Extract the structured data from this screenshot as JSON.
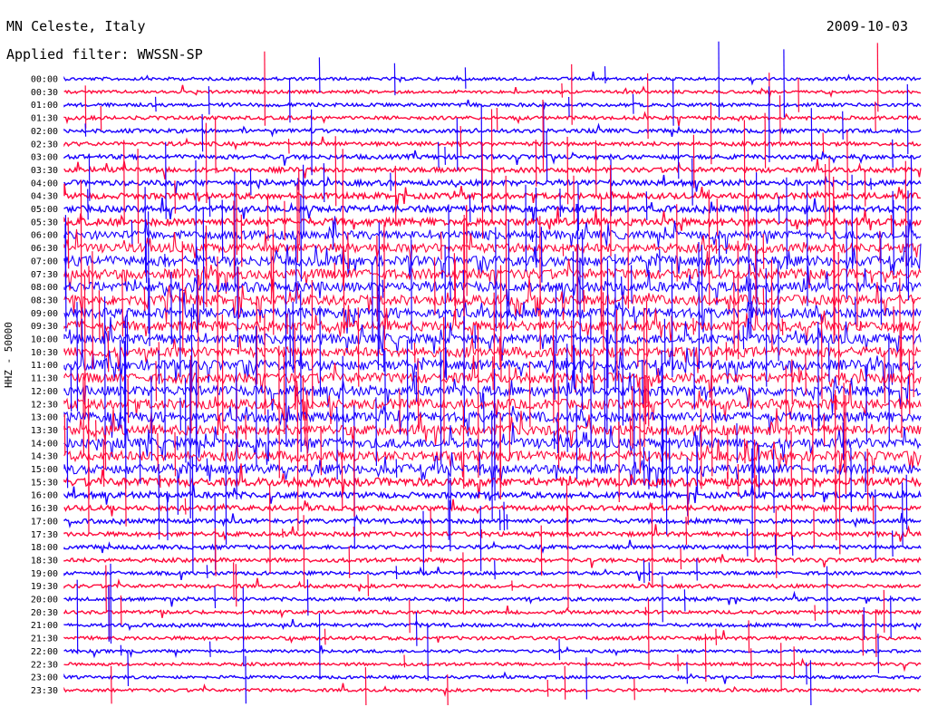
{
  "header": {
    "station": "MN Celeste, Italy",
    "date": "2009-10-03",
    "filter": "Applied filter: WWSSN-SP"
  },
  "chart_data": {
    "type": "line",
    "ylabel": "HHZ - 50000",
    "colors": {
      "blue": "#1a00ff",
      "red": "#ff0a3c"
    },
    "series": [
      {
        "label": "00:00",
        "color": "blue",
        "activity": 0.25
      },
      {
        "label": "00:30",
        "color": "red",
        "activity": 0.25
      },
      {
        "label": "01:00",
        "color": "blue",
        "activity": 0.3
      },
      {
        "label": "01:30",
        "color": "red",
        "activity": 0.3
      },
      {
        "label": "02:00",
        "color": "blue",
        "activity": 0.35
      },
      {
        "label": "02:30",
        "color": "red",
        "activity": 0.35
      },
      {
        "label": "03:00",
        "color": "blue",
        "activity": 0.4
      },
      {
        "label": "03:30",
        "color": "red",
        "activity": 0.45
      },
      {
        "label": "04:00",
        "color": "blue",
        "activity": 0.5
      },
      {
        "label": "04:30",
        "color": "red",
        "activity": 0.55
      },
      {
        "label": "05:00",
        "color": "blue",
        "activity": 0.6
      },
      {
        "label": "05:30",
        "color": "red",
        "activity": 0.7
      },
      {
        "label": "06:00",
        "color": "blue",
        "activity": 0.85
      },
      {
        "label": "06:30",
        "color": "red",
        "activity": 0.9
      },
      {
        "label": "07:00",
        "color": "blue",
        "activity": 1.0
      },
      {
        "label": "07:30",
        "color": "red",
        "activity": 1.0
      },
      {
        "label": "08:00",
        "color": "blue",
        "activity": 1.0
      },
      {
        "label": "08:30",
        "color": "red",
        "activity": 1.0
      },
      {
        "label": "09:00",
        "color": "blue",
        "activity": 1.0
      },
      {
        "label": "09:30",
        "color": "red",
        "activity": 1.0
      },
      {
        "label": "10:00",
        "color": "blue",
        "activity": 1.0
      },
      {
        "label": "10:30",
        "color": "red",
        "activity": 1.0
      },
      {
        "label": "11:00",
        "color": "blue",
        "activity": 1.0
      },
      {
        "label": "11:30",
        "color": "red",
        "activity": 1.0
      },
      {
        "label": "12:00",
        "color": "blue",
        "activity": 1.0
      },
      {
        "label": "12:30",
        "color": "red",
        "activity": 1.0
      },
      {
        "label": "13:00",
        "color": "blue",
        "activity": 1.0
      },
      {
        "label": "13:30",
        "color": "red",
        "activity": 1.0
      },
      {
        "label": "14:00",
        "color": "blue",
        "activity": 1.0
      },
      {
        "label": "14:30",
        "color": "red",
        "activity": 1.0
      },
      {
        "label": "15:00",
        "color": "blue",
        "activity": 0.95
      },
      {
        "label": "15:30",
        "color": "red",
        "activity": 0.8
      },
      {
        "label": "16:00",
        "color": "blue",
        "activity": 0.55
      },
      {
        "label": "16:30",
        "color": "red",
        "activity": 0.45
      },
      {
        "label": "17:00",
        "color": "blue",
        "activity": 0.4
      },
      {
        "label": "17:30",
        "color": "red",
        "activity": 0.4
      },
      {
        "label": "18:00",
        "color": "blue",
        "activity": 0.35
      },
      {
        "label": "18:30",
        "color": "red",
        "activity": 0.35
      },
      {
        "label": "19:00",
        "color": "blue",
        "activity": 0.3
      },
      {
        "label": "19:30",
        "color": "red",
        "activity": 0.3
      },
      {
        "label": "20:00",
        "color": "blue",
        "activity": 0.3
      },
      {
        "label": "20:30",
        "color": "red",
        "activity": 0.3
      },
      {
        "label": "21:00",
        "color": "blue",
        "activity": 0.3
      },
      {
        "label": "21:30",
        "color": "red",
        "activity": 0.3
      },
      {
        "label": "22:00",
        "color": "blue",
        "activity": 0.25
      },
      {
        "label": "22:30",
        "color": "red",
        "activity": 0.25
      },
      {
        "label": "23:00",
        "color": "blue",
        "activity": 0.25
      },
      {
        "label": "23:30",
        "color": "red",
        "activity": 0.25
      }
    ]
  }
}
